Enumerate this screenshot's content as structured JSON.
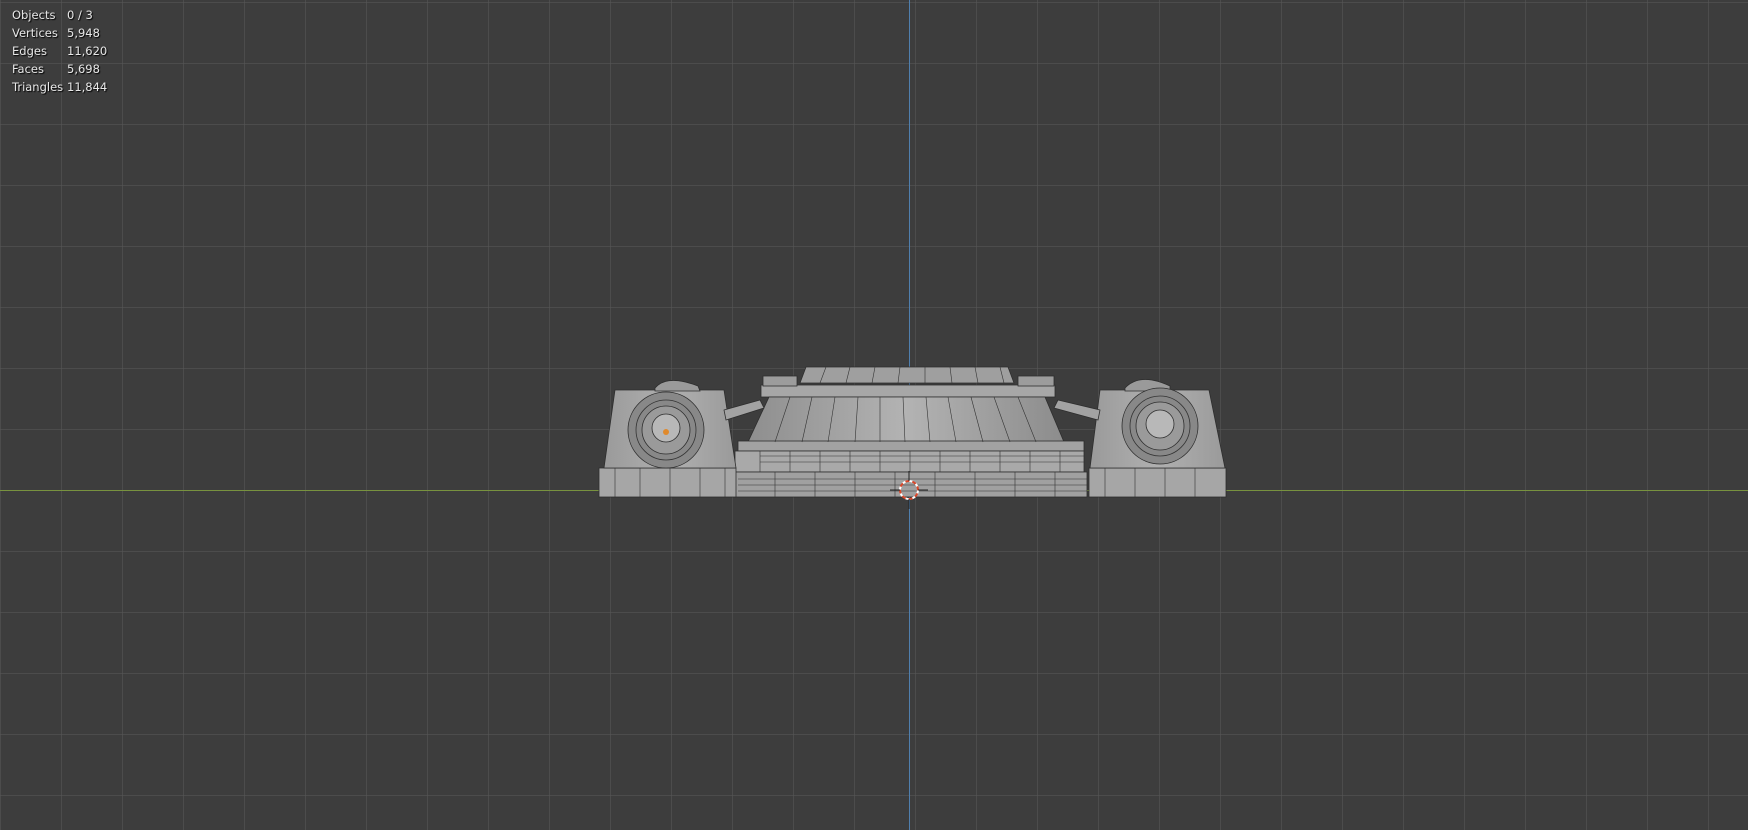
{
  "app": "Blender",
  "view": "3D Viewport",
  "statistics": [
    {
      "label": "Objects",
      "value": "0 / 3"
    },
    {
      "label": "Vertices",
      "value": "5,948"
    },
    {
      "label": "Edges",
      "value": "11,620"
    },
    {
      "label": "Faces",
      "value": "5,698"
    },
    {
      "label": "Triangles",
      "value": "11,844"
    }
  ],
  "colors": {
    "background": "#3d3d3d",
    "grid": "#585858",
    "axis_x": "#78923f",
    "axis_y": "#4f7fae",
    "mesh_fill": "#a8a8a8",
    "wire": "#2a2a2a",
    "cursor": "#d9482b"
  },
  "icons": {
    "cursor": "3d-cursor-icon",
    "origin": "object-origin-icon"
  }
}
